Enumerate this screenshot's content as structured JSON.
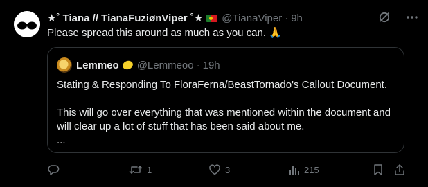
{
  "tweet": {
    "display_name": "★˚ Tiana // TianaFuziønViper ˚★",
    "flag_icon": "portugal-flag-icon",
    "handle": "@TianaViper",
    "time": "9h",
    "text": "Please spread this around as much as you can. 🙏"
  },
  "quoted_tweet": {
    "display_name": "Lemmeo",
    "emoji_icon": "lemon-icon",
    "handle": "@Lemmeoo",
    "time": "19h",
    "line1": "Stating & Responding To FloraFerna/BeastTornado's Callout Document.",
    "line2": "This will go over everything that was mentioned within the document and will clear up a lot of stuff that has been said about me.",
    "line3": "..."
  },
  "actions": {
    "replies": "",
    "retweets": "1",
    "likes": "3",
    "views": "215"
  },
  "separator": "·",
  "colors": {
    "background": "#000000",
    "text": "#e7e9ea",
    "muted": "#71767b",
    "border": "#2f3336"
  }
}
